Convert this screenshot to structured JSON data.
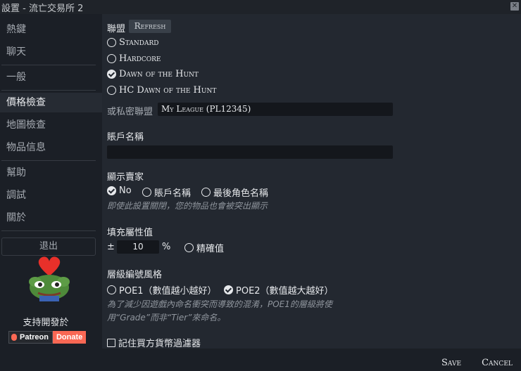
{
  "window": {
    "title": "設置 - 流亡交易所 2",
    "close_glyph": "✕"
  },
  "sidebar": {
    "items": [
      {
        "label": "熱鍵",
        "active": false
      },
      {
        "label": "聊天",
        "active": false
      },
      {
        "label": "一般",
        "active": false
      },
      {
        "label": "價格檢查",
        "active": true
      },
      {
        "label": "地圖檢查",
        "active": false
      },
      {
        "label": "物品信息",
        "active": false
      },
      {
        "label": "幫助",
        "active": false
      },
      {
        "label": "調試",
        "active": false
      },
      {
        "label": "關於",
        "active": false
      }
    ],
    "logout_label": "退出",
    "support_text": "支持開發於",
    "patreon_label": "Patreon",
    "donate_label": "Donate"
  },
  "league": {
    "label": "聯盟",
    "refresh_label": "Refresh",
    "options": [
      {
        "label": "Standard",
        "checked": false
      },
      {
        "label": "Hardcore",
        "checked": false
      },
      {
        "label": "Dawn of the Hunt",
        "checked": true
      },
      {
        "label": "HC Dawn of the Hunt",
        "checked": false
      }
    ],
    "private_label": "或私密聯盟",
    "private_value": "My League (PL12345)"
  },
  "account": {
    "label": "賬戶名稱",
    "value": ""
  },
  "show_seller": {
    "label": "顯示賣家",
    "options": [
      {
        "label": "No",
        "checked": true
      },
      {
        "label": "賬戶名稱",
        "checked": false
      },
      {
        "label": "最後角色名稱",
        "checked": false
      }
    ],
    "hint": "即使此設置關閉，您的物品也會被突出顯示"
  },
  "fill_stats": {
    "label": "填充屬性值",
    "prefix": "±",
    "value": "10",
    "unit": "%",
    "exact_label": "精確值",
    "exact_checked": false
  },
  "tier_style": {
    "label": "層級編號風格",
    "options": [
      {
        "label": "POE1（數值越小越好）",
        "checked": false
      },
      {
        "label": "POE2（數值越大越好）",
        "checked": true
      }
    ],
    "hint_line1": "為了減少因遊戲內命名衝突而導致的混淆，POE1的層級將使",
    "hint_line2": "用“Grade”而非“Tier”來命名。"
  },
  "remember_filter": {
    "label": "記住買方貨幣過濾器",
    "checked": false
  },
  "footer": {
    "save_label": "Save",
    "cancel_label": "Cancel"
  }
}
